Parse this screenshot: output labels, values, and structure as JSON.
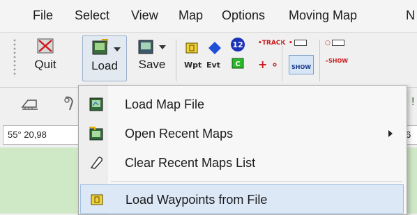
{
  "menubar": {
    "items": [
      "File",
      "Select",
      "View",
      "Map",
      "Options",
      "Moving Map",
      "N"
    ]
  },
  "toolbar": {
    "quit_label": "Quit",
    "load_label": "Load",
    "save_label": "Save",
    "wpt_label": "Wpt",
    "evt_label": "Evt",
    "track_label": "TRACK",
    "waypoint_number": "12",
    "show_label": "SHOW",
    "show_label_2": "SHOW"
  },
  "coords": {
    "lat": "55° 20,98",
    "right_fragment": "6"
  },
  "dropdown": {
    "items": [
      {
        "label": "Load Map File",
        "has_submenu": false
      },
      {
        "label": "Open Recent Maps",
        "has_submenu": true
      },
      {
        "label": "Clear Recent Maps List",
        "has_submenu": false
      },
      {
        "label": "Load Waypoints from File",
        "has_submenu": false,
        "highlighted": true
      }
    ]
  },
  "colors": {
    "highlight_bg": "#dce8f6",
    "highlight_border": "#9fbde0",
    "map_green": "#cfe9c7",
    "waypoint_yellow": "#f2d23a",
    "event_blue": "#1f4fd8",
    "track_red": "#d21c1c"
  }
}
